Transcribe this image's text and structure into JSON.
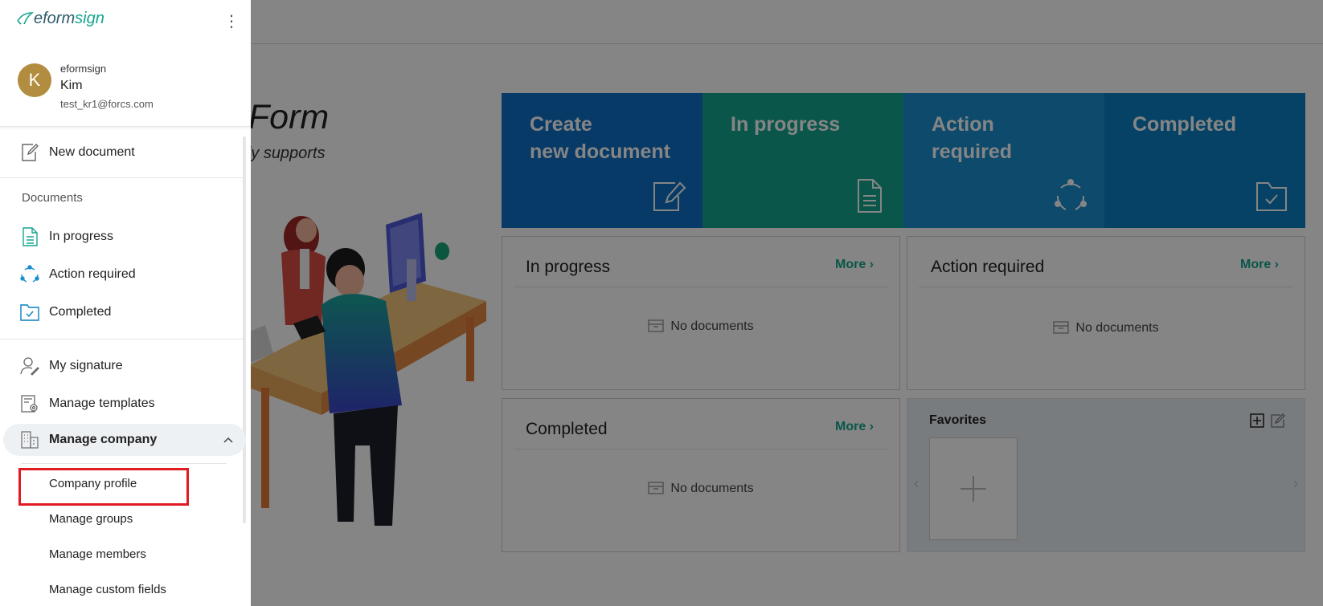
{
  "hero": {
    "title": "bile Form",
    "subtitle": "which fully supports"
  },
  "tiles": [
    {
      "label": "Create\nnew document",
      "icon": "edit-document-icon",
      "color": "#0f6fc6"
    },
    {
      "label": "In progress",
      "icon": "document-icon",
      "color": "#14a58e"
    },
    {
      "label": "Action\nrequired",
      "icon": "cycle-icon",
      "color": "#1a8fd0"
    },
    {
      "label": "Completed",
      "icon": "folder-check-icon",
      "color": "#0b7fc1"
    }
  ],
  "cards": {
    "in_progress": {
      "title": "In progress",
      "more": "More",
      "empty": "No documents"
    },
    "action_required": {
      "title": "Action required",
      "more": "More",
      "empty": "No documents"
    },
    "completed": {
      "title": "Completed",
      "more": "More",
      "empty": "No documents"
    }
  },
  "favorites": {
    "title": "Favorites"
  },
  "sidebar": {
    "logo": {
      "brand_a": "eform",
      "brand_b": "sign"
    },
    "user": {
      "initial": "K",
      "company": "eformsign",
      "name": "Kim",
      "email": "test_kr1@forcs.com"
    },
    "new_document": "New document",
    "documents_section": "Documents",
    "documents": [
      {
        "label": "In progress",
        "icon": "document-icon"
      },
      {
        "label": "Action required",
        "icon": "cycle-icon"
      },
      {
        "label": "Completed",
        "icon": "folder-check-icon"
      }
    ],
    "my_signature": "My signature",
    "manage_templates": "Manage templates",
    "manage_company": "Manage company",
    "company_sub": [
      "Company profile",
      "Manage groups",
      "Manage members",
      "Manage custom fields"
    ]
  },
  "colors": {
    "accent": "#14a58e",
    "highlight": "#e01b22",
    "avatar": "#b28c3f"
  }
}
